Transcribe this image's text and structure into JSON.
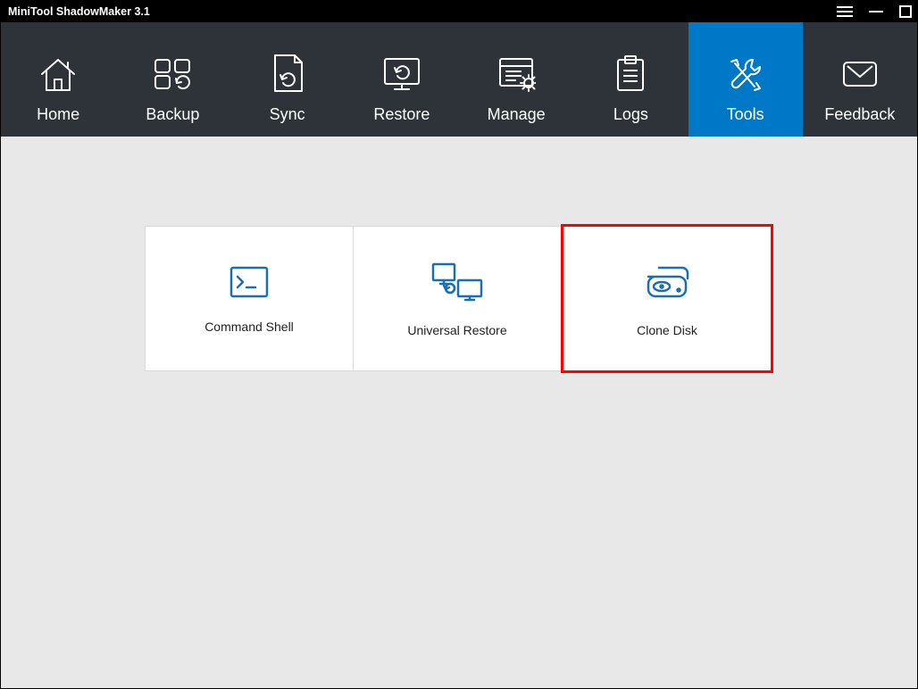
{
  "app": {
    "title": "MiniTool ShadowMaker 3.1"
  },
  "nav": {
    "home": {
      "label": "Home"
    },
    "backup": {
      "label": "Backup"
    },
    "sync": {
      "label": "Sync"
    },
    "restore": {
      "label": "Restore"
    },
    "manage": {
      "label": "Manage"
    },
    "logs": {
      "label": "Logs"
    },
    "tools": {
      "label": "Tools"
    },
    "feedback": {
      "label": "Feedback"
    }
  },
  "tools": {
    "command_shell": {
      "label": "Command Shell"
    },
    "universal_restore": {
      "label": "Universal Restore"
    },
    "clone_disk": {
      "label": "Clone Disk"
    }
  },
  "colors": {
    "accent": "#0078c8",
    "icon_blue": "#1a6fb0",
    "highlight": "#ff0000"
  }
}
